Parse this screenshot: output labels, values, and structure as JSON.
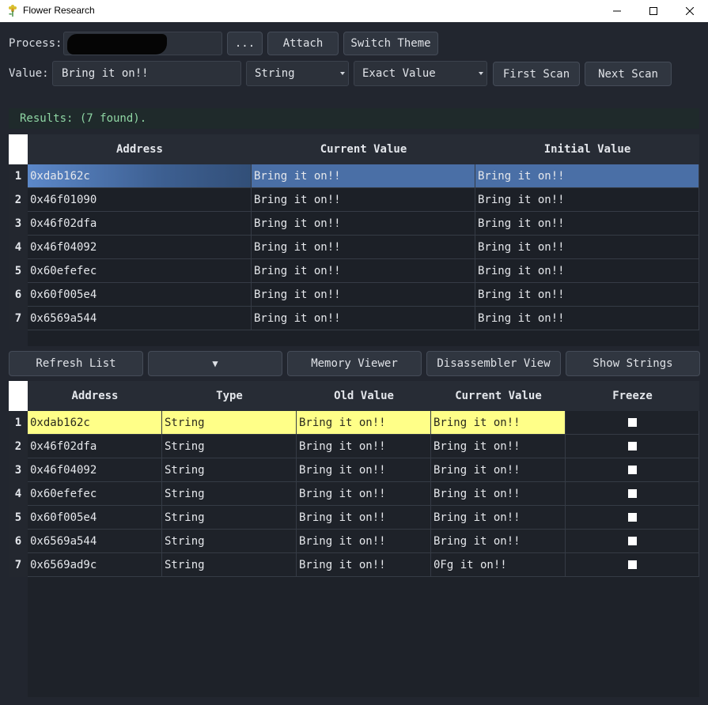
{
  "window": {
    "title": "Flower Research",
    "controls": {
      "minimize": "—",
      "maximize": "☐",
      "close": "✕"
    }
  },
  "toolbar": {
    "process_label": "Process:",
    "process_value": "",
    "browse_label": "...",
    "attach_label": "Attach",
    "switch_theme_label": "Switch Theme",
    "value_label": "Value:",
    "value_input": "Bring it on!!",
    "type_select": "String",
    "scan_mode_select": "Exact Value",
    "first_scan_label": "First Scan",
    "next_scan_label": "Next Scan"
  },
  "results": {
    "status": "Results: (7 found).",
    "headers": [
      "Address",
      "Current Value",
      "Initial Value"
    ],
    "rows": [
      {
        "n": "1",
        "address": "0xdab162c",
        "current": "Bring it on!!",
        "initial": "Bring it on!!",
        "selected": true
      },
      {
        "n": "2",
        "address": "0x46f01090",
        "current": "Bring it on!!",
        "initial": "Bring it on!!"
      },
      {
        "n": "3",
        "address": "0x46f02dfa",
        "current": "Bring it on!!",
        "initial": "Bring it on!!"
      },
      {
        "n": "4",
        "address": "0x46f04092",
        "current": "Bring it on!!",
        "initial": "Bring it on!!"
      },
      {
        "n": "5",
        "address": "0x60efefec",
        "current": "Bring it on!!",
        "initial": "Bring it on!!"
      },
      {
        "n": "6",
        "address": "0x60f005e4",
        "current": "Bring it on!!",
        "initial": "Bring it on!!"
      },
      {
        "n": "7",
        "address": "0x6569a544",
        "current": "Bring it on!!",
        "initial": "Bring it on!!"
      }
    ]
  },
  "actions": {
    "refresh_label": "Refresh List",
    "dropdown_label": "▼",
    "memory_viewer_label": "Memory Viewer",
    "disassembler_label": "Disassembler View",
    "show_strings_label": "Show Strings"
  },
  "watchlist": {
    "headers": [
      "Address",
      "Type",
      "Old Value",
      "Current Value",
      "Freeze"
    ],
    "rows": [
      {
        "n": "1",
        "address": "0xdab162c",
        "type": "String",
        "old": "Bring it on!!",
        "current": "Bring it on!!",
        "freeze": false,
        "highlight": true
      },
      {
        "n": "2",
        "address": "0x46f02dfa",
        "type": "String",
        "old": "Bring it on!!",
        "current": "Bring it on!!",
        "freeze": false
      },
      {
        "n": "3",
        "address": "0x46f04092",
        "type": "String",
        "old": "Bring it on!!",
        "current": "Bring it on!!",
        "freeze": false
      },
      {
        "n": "4",
        "address": "0x60efefec",
        "type": "String",
        "old": "Bring it on!!",
        "current": "Bring it on!!",
        "freeze": false
      },
      {
        "n": "5",
        "address": "0x60f005e4",
        "type": "String",
        "old": "Bring it on!!",
        "current": "Bring it on!!",
        "freeze": false
      },
      {
        "n": "6",
        "address": "0x6569a544",
        "type": "String",
        "old": "Bring it on!!",
        "current": "Bring it on!!",
        "freeze": false
      },
      {
        "n": "7",
        "address": "0x6569ad9c",
        "type": "String",
        "old": "Bring it on!!",
        "current": "0Fg it on!!",
        "freeze": false
      }
    ]
  },
  "colors": {
    "background": "#22262f",
    "selection_blue": "#4a6fa6",
    "highlight_yellow": "#ffff88",
    "status_green": "#8fd6a4"
  }
}
